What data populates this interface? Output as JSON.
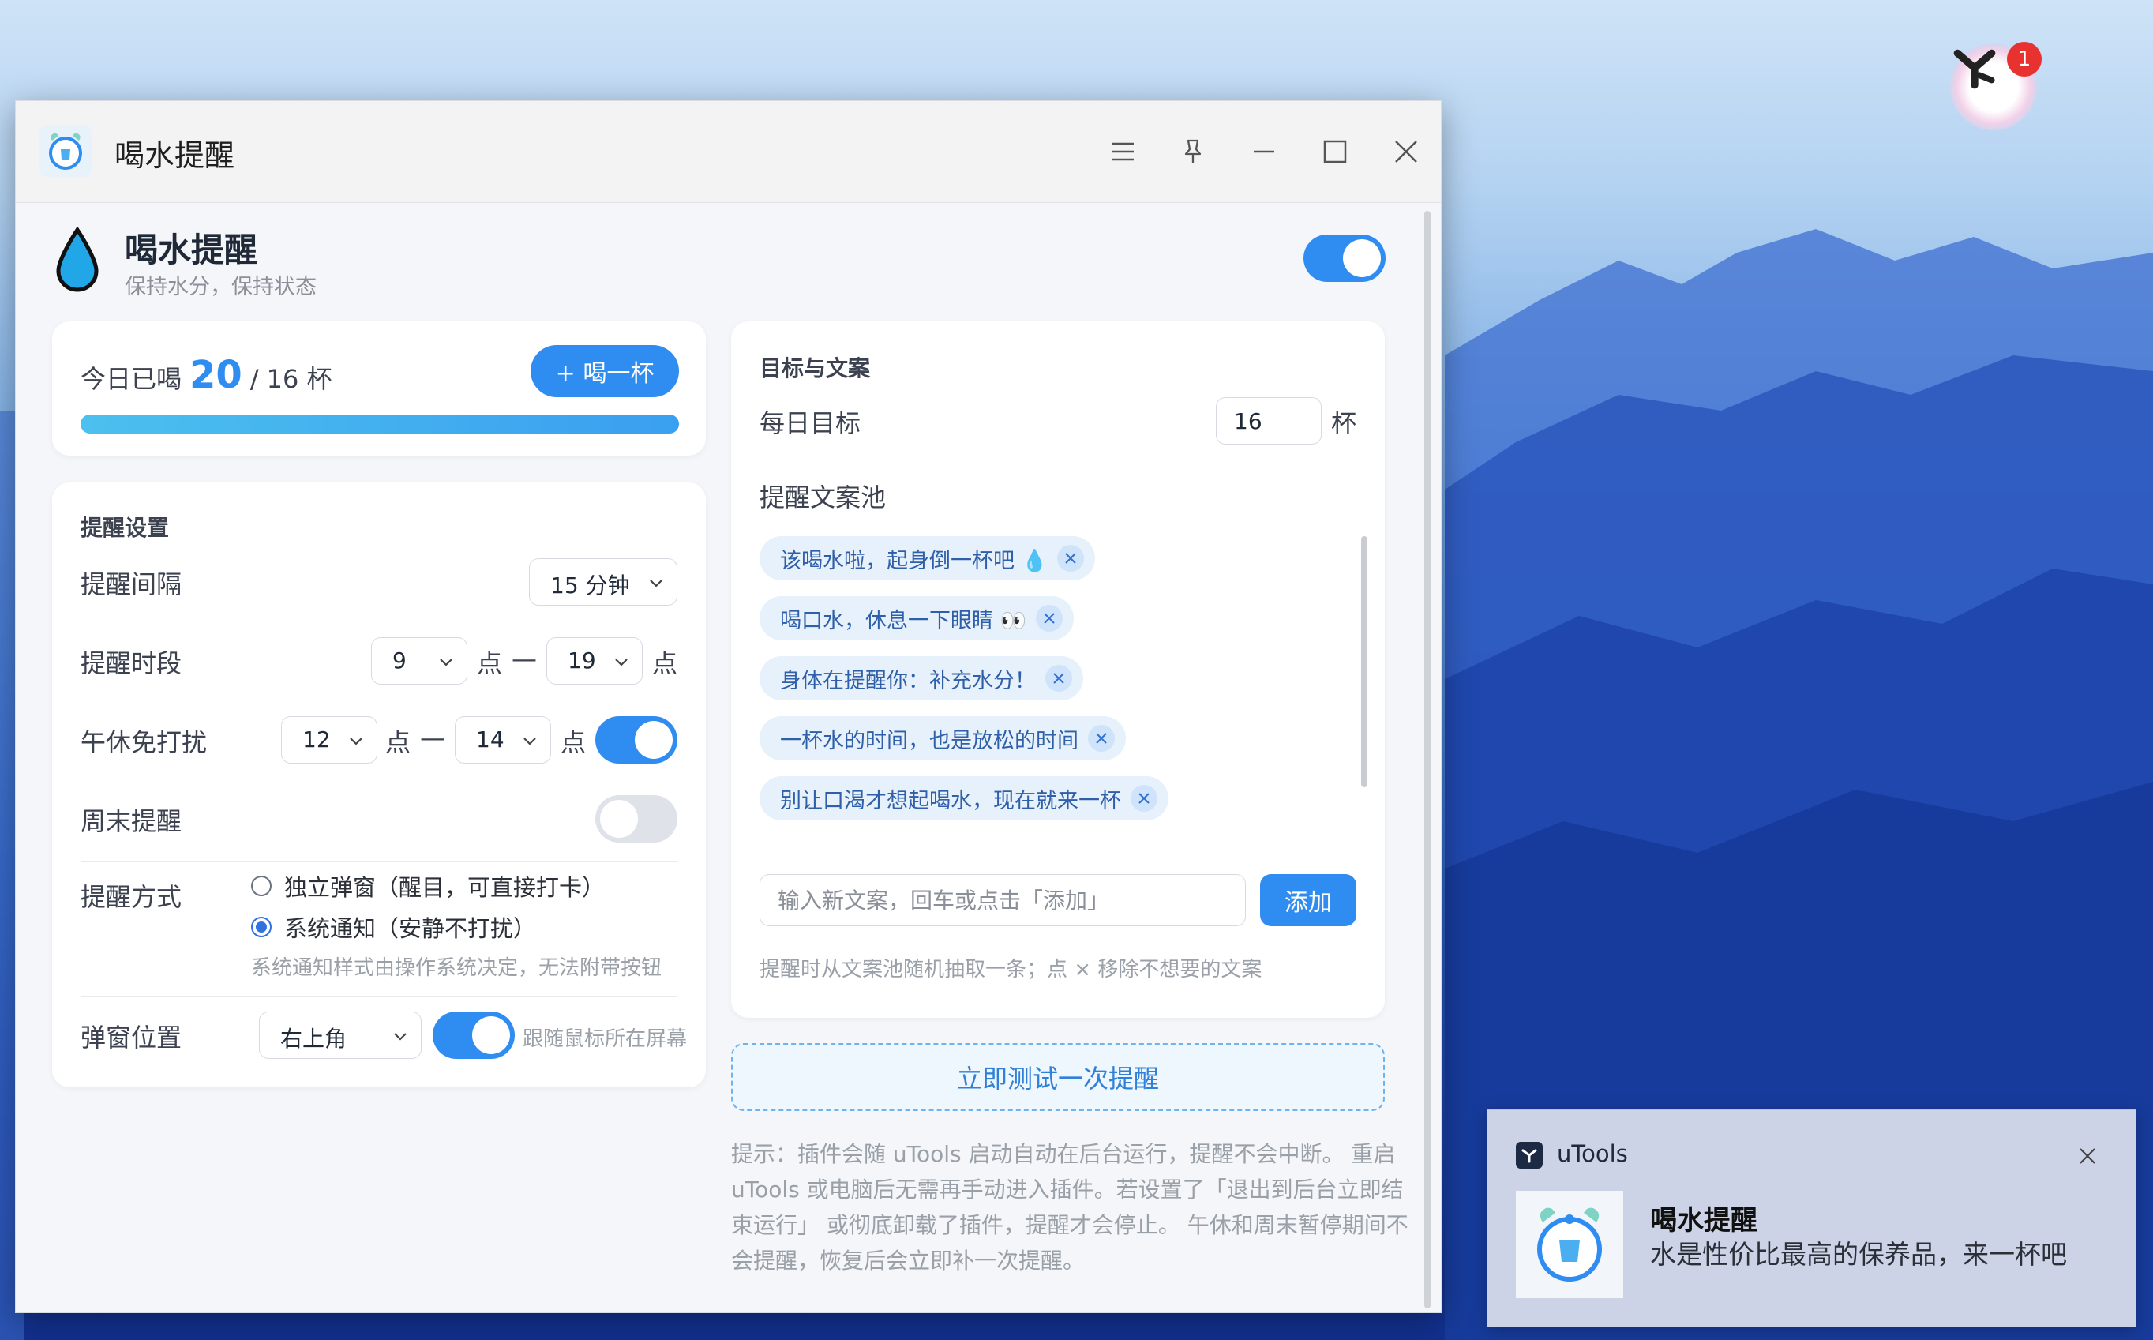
{
  "window": {
    "title": "喝水提醒",
    "icon": "alarm-clock-water-icon"
  },
  "header": {
    "title": "喝水提醒",
    "subtitle": "保持水分，保持状态",
    "enabled": true
  },
  "today": {
    "label_prefix": "今日已喝",
    "count": "20",
    "separator": "/",
    "goal": "16 杯",
    "drink_button": "+ 喝一杯",
    "progress": 1.0
  },
  "reminder_settings": {
    "title": "提醒设置",
    "interval": {
      "label": "提醒间隔",
      "value": "15 分钟"
    },
    "period": {
      "label": "提醒时段",
      "start": "9",
      "end": "19",
      "unit": "点",
      "dash": "—"
    },
    "nap": {
      "label": "午休免打扰",
      "start": "12",
      "end": "14",
      "unit": "点",
      "dash": "—",
      "enabled": true
    },
    "weekend": {
      "label": "周末提醒",
      "enabled": false
    },
    "method": {
      "label": "提醒方式",
      "options": [
        {
          "text": "独立弹窗（醒目，可直接打卡）",
          "checked": false
        },
        {
          "text": "系统通知（安静不打扰）",
          "checked": true
        }
      ],
      "note": "系统通知样式由操作系统决定，无法附带按钮"
    },
    "popup_position": {
      "label": "弹窗位置",
      "value": "右上角",
      "follow_mouse": true,
      "follow_mouse_label": "跟随鼠标所在屏幕"
    }
  },
  "goals": {
    "title": "目标与文案",
    "daily_goal_label": "每日目标",
    "daily_goal_value": "16",
    "daily_goal_unit": "杯",
    "pool_title": "提醒文案池",
    "pool": [
      "该喝水啦，起身倒一杯吧 💧",
      "喝口水，休息一下眼睛 👀",
      "身体在提醒你：补充水分！",
      "一杯水的时间，也是放松的时间",
      "别让口渴才想起喝水，现在就来一杯"
    ],
    "new_placeholder": "输入新文案，回车或点击「添加」",
    "add_button": "添加",
    "pool_hint": "提醒时从文案池随机抽取一条；点 × 移除不想要的文案"
  },
  "test_button": "立即测试一次提醒",
  "tips": [
    "提示：插件会随 uTools 启动自动在后台运行，提醒不会中断。 重启",
    "uTools 或电脑后无需再手动进入插件。若设置了「退出到后台立即结",
    "束运行」 或彻底卸载了插件，提醒才会停止。 午休和周末暂停期间不",
    "会提醒，恢复后会立即补一次提醒。"
  ],
  "notification": {
    "app": "uTools",
    "title": "喝水提醒",
    "body": "水是性价比最高的保养品，来一杯吧"
  },
  "desktop": {
    "utools_badge": "1"
  },
  "colors": {
    "accent": "#2f8cf0",
    "chip_bg": "#e6f1fc",
    "progress": "#4aaef0"
  }
}
